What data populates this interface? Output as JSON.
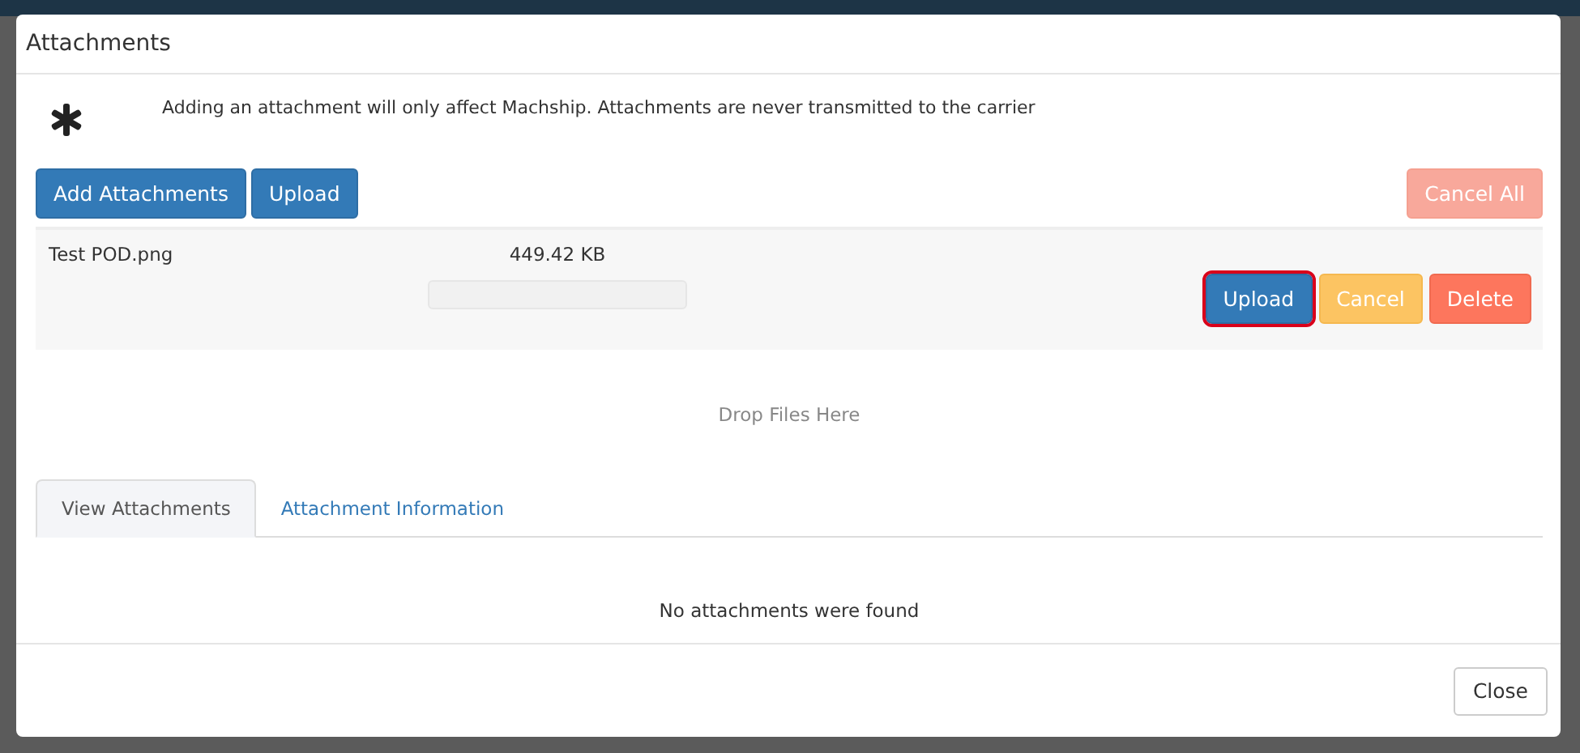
{
  "dialog": {
    "title": "Attachments",
    "notice": "Adding an attachment will only affect Machship. Attachments are never transmitted to the carrier",
    "toolbar": [
      {
        "label": "Add Attachments",
        "kind": "primary"
      },
      {
        "label": "Upload",
        "kind": "primary"
      },
      {
        "label": "Cancel All",
        "kind": "danger-muted"
      }
    ],
    "files": [
      {
        "name": "Test POD.png",
        "size": "449.42 KB",
        "level": 0,
        "actions": [
          {
            "label": "Upload",
            "kind": "primary",
            "focused": true
          },
          {
            "label": "Cancel",
            "kind": "warning",
            "focused": false
          },
          {
            "label": "Delete",
            "kind": "danger",
            "focused": false
          }
        ]
      }
    ],
    "drop_zone": "Drop Files Here",
    "tabs": [
      {
        "label": "View Attachments",
        "selected": true
      },
      {
        "label": "Attachment Information",
        "selected": false
      }
    ],
    "empty_message": "No attachments were found",
    "footer_buttons": [
      "Close"
    ]
  }
}
